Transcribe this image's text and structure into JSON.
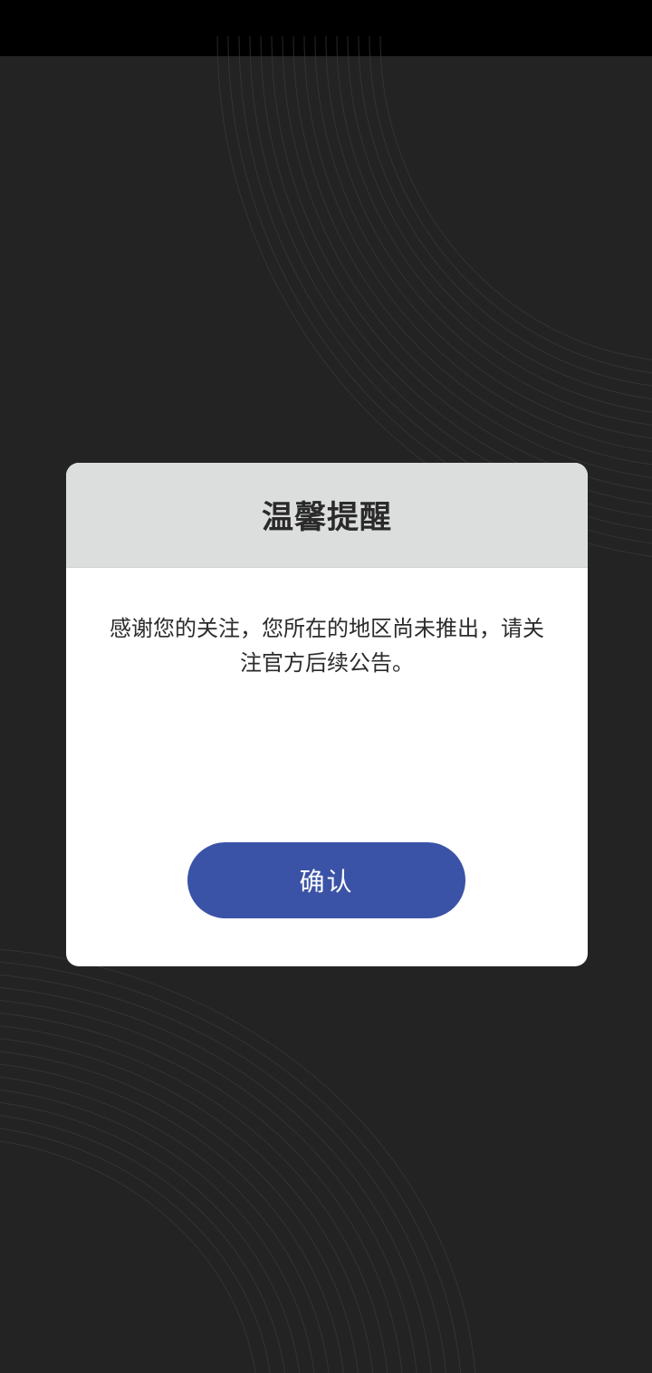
{
  "dialog": {
    "title": "温馨提醒",
    "message": "感谢您的关注，您所在的地区尚未推出，请关注官方后续公告。",
    "confirm_label": "确认"
  },
  "colors": {
    "background": "#232323",
    "status_bar": "#000000",
    "dialog_header": "#dcdedd",
    "dialog_body": "#ffffff",
    "confirm_button": "#3b53a6"
  }
}
